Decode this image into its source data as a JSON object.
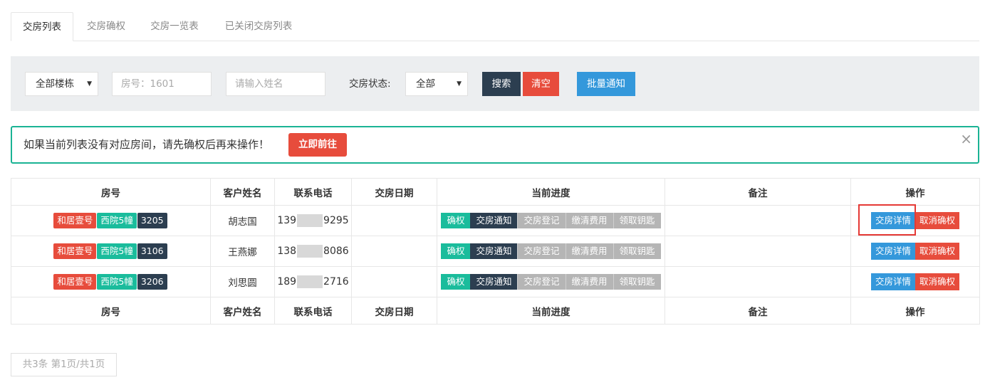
{
  "tabs": [
    "交房列表",
    "交房确权",
    "交房一览表",
    "已关闭交房列表"
  ],
  "filter": {
    "building_select": "全部楼栋",
    "room_placeholder": "房号：1601",
    "name_placeholder": "请输入姓名",
    "status_label": "交房状态:",
    "status_select": "全部",
    "search_label": "搜索",
    "clear_label": "清空",
    "batch_notify_label": "批量通知"
  },
  "alert": {
    "text": "如果当前列表没有对应房间，请先确权后再来操作！",
    "button_label": "立即前往",
    "close": "×"
  },
  "table": {
    "headers": [
      "房号",
      "客户姓名",
      "联系电话",
      "交房日期",
      "当前进度",
      "备注",
      "操作"
    ],
    "steps": [
      "确权",
      "交房通知",
      "交房登记",
      "缴清费用",
      "领取钥匙"
    ],
    "actions": [
      "交房详情",
      "取消确权"
    ],
    "rows": [
      {
        "project": "和居壹号",
        "building": "西院5幢",
        "room": "3205",
        "name": "胡志国",
        "phone_prefix": "139",
        "phone_suffix": "9295",
        "date": "",
        "note": ""
      },
      {
        "project": "和居壹号",
        "building": "西院5幢",
        "room": "3106",
        "name": "王燕娜",
        "phone_prefix": "138",
        "phone_suffix": "8086",
        "date": "",
        "note": ""
      },
      {
        "project": "和居壹号",
        "building": "西院5幢",
        "room": "3206",
        "name": "刘思圆",
        "phone_prefix": "189",
        "phone_suffix": "2716",
        "date": "",
        "note": ""
      }
    ]
  },
  "pager": "共3条  第1页/共1页",
  "colors": {
    "accent_teal": "#1abc9c",
    "danger_red": "#e74c3c",
    "dark_navy": "#2c3e50",
    "primary_blue": "#3498db",
    "step_inactive_grey": "#b5b5b5"
  }
}
